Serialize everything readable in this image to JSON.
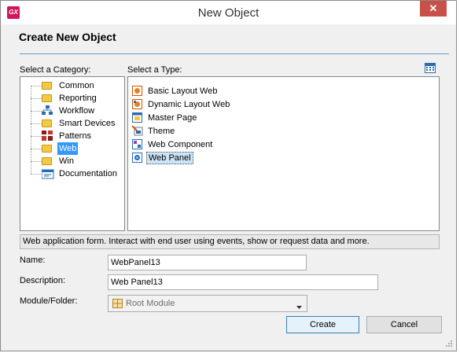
{
  "window": {
    "title": "New Object",
    "app_icon": "GX",
    "close_glyph": "✕"
  },
  "header": {
    "title": "Create New Object"
  },
  "category": {
    "label": "Select a Category:",
    "items": [
      {
        "label": "Common",
        "icon": "folder-icon"
      },
      {
        "label": "Reporting",
        "icon": "folder-icon"
      },
      {
        "label": "Workflow",
        "icon": "workflow-icon"
      },
      {
        "label": "Smart Devices",
        "icon": "folder-icon"
      },
      {
        "label": "Patterns",
        "icon": "patterns-icon"
      },
      {
        "label": "Web",
        "icon": "folder-icon",
        "selected": true
      },
      {
        "label": "Win",
        "icon": "folder-icon"
      },
      {
        "label": "Documentation",
        "icon": "documentation-icon"
      }
    ]
  },
  "type": {
    "label": "Select a Type:",
    "items": [
      {
        "label": "Basic Layout Web",
        "icon": "basic-layout-web-icon"
      },
      {
        "label": "Dynamic Layout Web",
        "icon": "dynamic-layout-web-icon"
      },
      {
        "label": "Master Page",
        "icon": "master-page-icon"
      },
      {
        "label": "Theme",
        "icon": "theme-icon"
      },
      {
        "label": "Web Component",
        "icon": "web-component-icon"
      },
      {
        "label": "Web Panel",
        "icon": "web-panel-icon",
        "selected": true
      }
    ]
  },
  "description_bar": "Web application form. Interact with end user using events, show or request data and more.",
  "form": {
    "name_label": "Name:",
    "name_value": "WebPanel13",
    "description_label": "Description:",
    "description_value": "Web Panel13",
    "module_label": "Module/Folder:",
    "module_value": "Root Module"
  },
  "buttons": {
    "create": "Create",
    "cancel": "Cancel"
  },
  "colors": {
    "accent": "#3399ff",
    "close": "#c7504a",
    "brand": "#d4145a"
  }
}
